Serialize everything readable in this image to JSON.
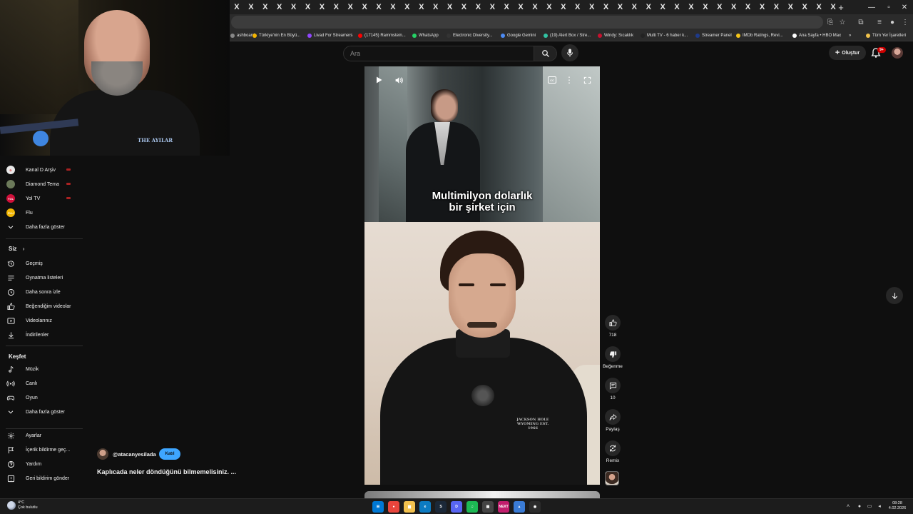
{
  "browser": {
    "tab_count": 43,
    "tab_favicon_glyph": "X",
    "new_tab_label": "+",
    "bookmarks": [
      {
        "label": "ashboard",
        "color": "#888888"
      },
      {
        "label": "Türkiye'nin En Büyü...",
        "color": "#f4b400"
      },
      {
        "label": "Livad For Streamers",
        "color": "#9146ff"
      },
      {
        "label": "(17145) Rammstein...",
        "color": "#ff0000"
      },
      {
        "label": "WhatsApp",
        "color": "#25d366"
      },
      {
        "label": "Electronic Diversity...",
        "color": "#333333"
      },
      {
        "label": "Google Gemini",
        "color": "#4c8bf5"
      },
      {
        "label": "(19) Alert Box / Stre...",
        "color": "#31c3a2"
      },
      {
        "label": "Windy: Sıcaklık",
        "color": "#c8102e"
      },
      {
        "label": "Multi TV - 6 haber k...",
        "color": "#222222"
      },
      {
        "label": "Streamer Panel",
        "color": "#1e3a8a"
      },
      {
        "label": "IMDb Ratings, Revi...",
        "color": "#f5c518"
      },
      {
        "label": "Ana Sayfa • HBO Max",
        "color": "#ffffff"
      },
      {
        "label": "»",
        "color": null
      },
      {
        "label": "Tüm Yer İşaretleri",
        "color": "#f0c24b"
      }
    ]
  },
  "header": {
    "search_placeholder": "Ara",
    "create_label": "Oluştur",
    "notification_badge": "9+"
  },
  "sidebar": {
    "subscriptions": [
      {
        "label": "Kanal D Arşiv",
        "avatar_color": "#e8e8e8",
        "avatar_text": "D",
        "live": true
      },
      {
        "label": "Diamond Tema",
        "avatar_color": "#6c7a5a",
        "avatar_text": "",
        "live": true
      },
      {
        "label": "Yol TV",
        "avatar_color": "#d0103a",
        "avatar_text": "YOL",
        "live": true
      },
      {
        "label": "Flu",
        "avatar_color": "#f2b705",
        "avatar_text": "FLU",
        "live": false
      }
    ],
    "show_more_1": "Daha fazla göster",
    "you_header": "Siz",
    "you_items": [
      {
        "label": "Geçmiş",
        "icon": "history-icon"
      },
      {
        "label": "Oynatma listeleri",
        "icon": "playlist-icon"
      },
      {
        "label": "Daha sonra izle",
        "icon": "clock-icon"
      },
      {
        "label": "Beğendiğim videolar",
        "icon": "thumbs-up-icon"
      },
      {
        "label": "Videolarınız",
        "icon": "video-icon"
      },
      {
        "label": "İndirilenler",
        "icon": "download-icon"
      }
    ],
    "explore_header": "Keşfet",
    "explore_items": [
      {
        "label": "Müzik",
        "icon": "music-note-icon"
      },
      {
        "label": "Canlı",
        "icon": "live-icon"
      },
      {
        "label": "Oyun",
        "icon": "gamepad-icon"
      },
      {
        "label": "Daha fazla göster",
        "icon": "chevron-down-icon"
      }
    ],
    "settings_items": [
      {
        "label": "Ayarlar",
        "icon": "gear-icon"
      },
      {
        "label": "İçerik bildirme geç...",
        "icon": "flag-icon"
      },
      {
        "label": "Yardım",
        "icon": "help-icon"
      },
      {
        "label": "Geri bildirim gönder",
        "icon": "feedback-icon"
      }
    ]
  },
  "short": {
    "caption_line1": "Multimilyon dolarlık",
    "caption_line2": "bir şirket için",
    "shirt_logo": "JACKSON HOLE WYOMING EST. 1966"
  },
  "actions": {
    "like_count": "718",
    "dislike_label": "Beğenme",
    "comment_count": "10",
    "share_label": "Paylaş",
    "remix_label": "Remix"
  },
  "channel": {
    "handle": "@atacanyesilada",
    "join_label": "Katıl",
    "video_title": "Kaplıcada neler döndüğünü bilmemelisiniz. ..."
  },
  "webcam": {
    "shirt_text": "THE AYILAR"
  },
  "taskbar": {
    "weather_temp": "4°C",
    "weather_desc": "Çok bulutlu",
    "time": "08:28",
    "date": "4.02.2026",
    "apps": [
      {
        "name": "windows-start-icon",
        "color": "#0078d4",
        "glyph": "⊞"
      },
      {
        "name": "chrome-icon",
        "color": "#e8453c",
        "glyph": "●"
      },
      {
        "name": "file-explorer-icon",
        "color": "#f2c14e",
        "glyph": "▆"
      },
      {
        "name": "edge-icon",
        "color": "#0c7bc2",
        "glyph": "e"
      },
      {
        "name": "steam-icon",
        "color": "#1b2838",
        "glyph": "S"
      },
      {
        "name": "discord-icon",
        "color": "#5865f2",
        "glyph": "D"
      },
      {
        "name": "spotify-icon",
        "color": "#1db954",
        "glyph": "♫"
      },
      {
        "name": "calculator-icon",
        "color": "#444444",
        "glyph": "▦"
      },
      {
        "name": "next-icon",
        "color": "#c21d6d",
        "glyph": "NEXT"
      },
      {
        "name": "streamer-app-icon",
        "color": "#3a7bd5",
        "glyph": "▲"
      },
      {
        "name": "obs-icon",
        "color": "#2b2b2b",
        "glyph": "◉"
      }
    ]
  }
}
